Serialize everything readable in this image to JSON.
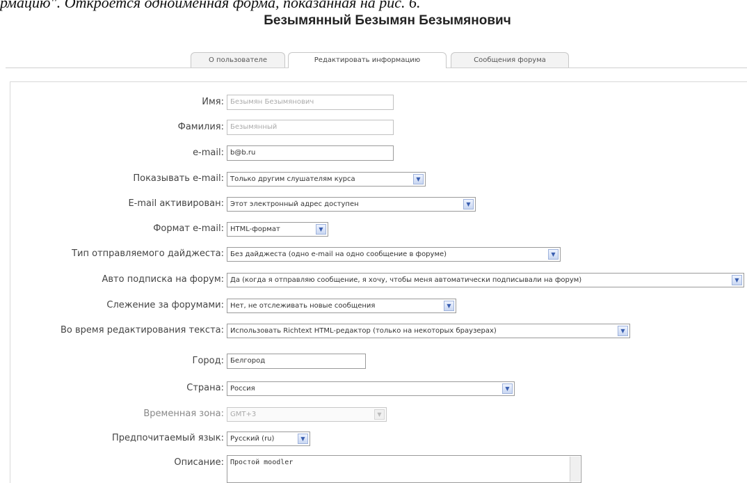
{
  "document": {
    "intro": "рмацию\". Откроется одноименная форма, показанная на рис. 6."
  },
  "page": {
    "title": "Безымянный Безымян Безымянович"
  },
  "tabs": [
    {
      "label": "О пользователе",
      "active": false
    },
    {
      "label": "Редактировать информацию",
      "active": true
    },
    {
      "label": "Сообщения форума",
      "active": false
    }
  ],
  "form": {
    "firstname": {
      "label": "Имя:",
      "value": "Безымян Безымянович"
    },
    "lastname": {
      "label": "Фамилия:",
      "value": "Безымянный"
    },
    "email": {
      "label": "e-mail:",
      "value": "b@b.ru"
    },
    "maildisplay": {
      "label": "Показывать e-mail:",
      "value": "Только другим слушателям курса"
    },
    "emailstop": {
      "label": "E-mail активирован:",
      "value": "Этот электронный адрес доступен"
    },
    "mailformat": {
      "label": "Формат e-mail:",
      "value": "HTML-формат"
    },
    "maildigest": {
      "label": "Тип отправляемого дайджеста:",
      "value": "Без дайджеста (одно e-mail на одно сообщение в форуме)"
    },
    "autosubscribe": {
      "label": "Авто подписка на форум:",
      "value": "Да (когда я отправляю сообщение, я хочу, чтобы меня автоматически подписывали на форум)"
    },
    "trackforums": {
      "label": "Слежение за форумами:",
      "value": "Нет, не отслеживать новые сообщения"
    },
    "htmleditor": {
      "label": "Во время редактирования текста:",
      "value": "Использовать Richtext HTML-редактор (только на некоторых браузерах)"
    },
    "city": {
      "label": "Город:",
      "value": "Белгород"
    },
    "country": {
      "label": "Страна:",
      "value": "Россия"
    },
    "timezone": {
      "label": "Временная зона:",
      "value": "GMT+3"
    },
    "lang": {
      "label": "Предпочитаемый язык:",
      "value": "Русский (ru)"
    },
    "description": {
      "label": "Описание:",
      "value": "Простой moodler"
    }
  },
  "icons": {
    "dropdown": "chevron-down-icon"
  },
  "colors": {
    "accent": "#3a5fb0",
    "border": "#9a9a9a"
  }
}
